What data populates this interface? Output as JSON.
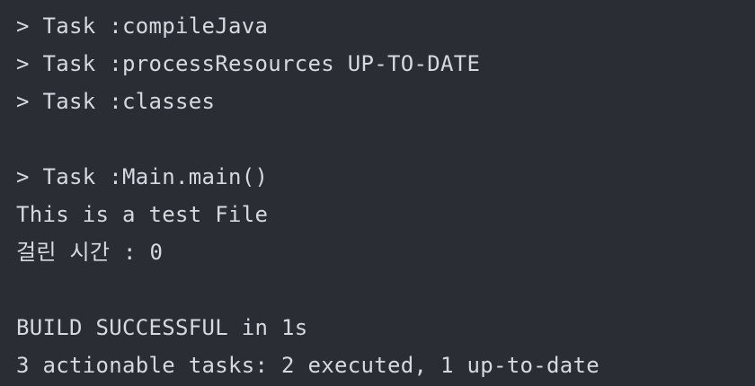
{
  "console": {
    "lines": [
      "> Task :compileJava",
      "> Task :processResources UP-TO-DATE",
      "> Task :classes",
      "",
      "> Task :Main.main()",
      "This is a test File",
      "걸린 시간 : 0",
      "",
      "BUILD SUCCESSFUL in 1s",
      "3 actionable tasks: 2 executed, 1 up-to-date"
    ]
  }
}
